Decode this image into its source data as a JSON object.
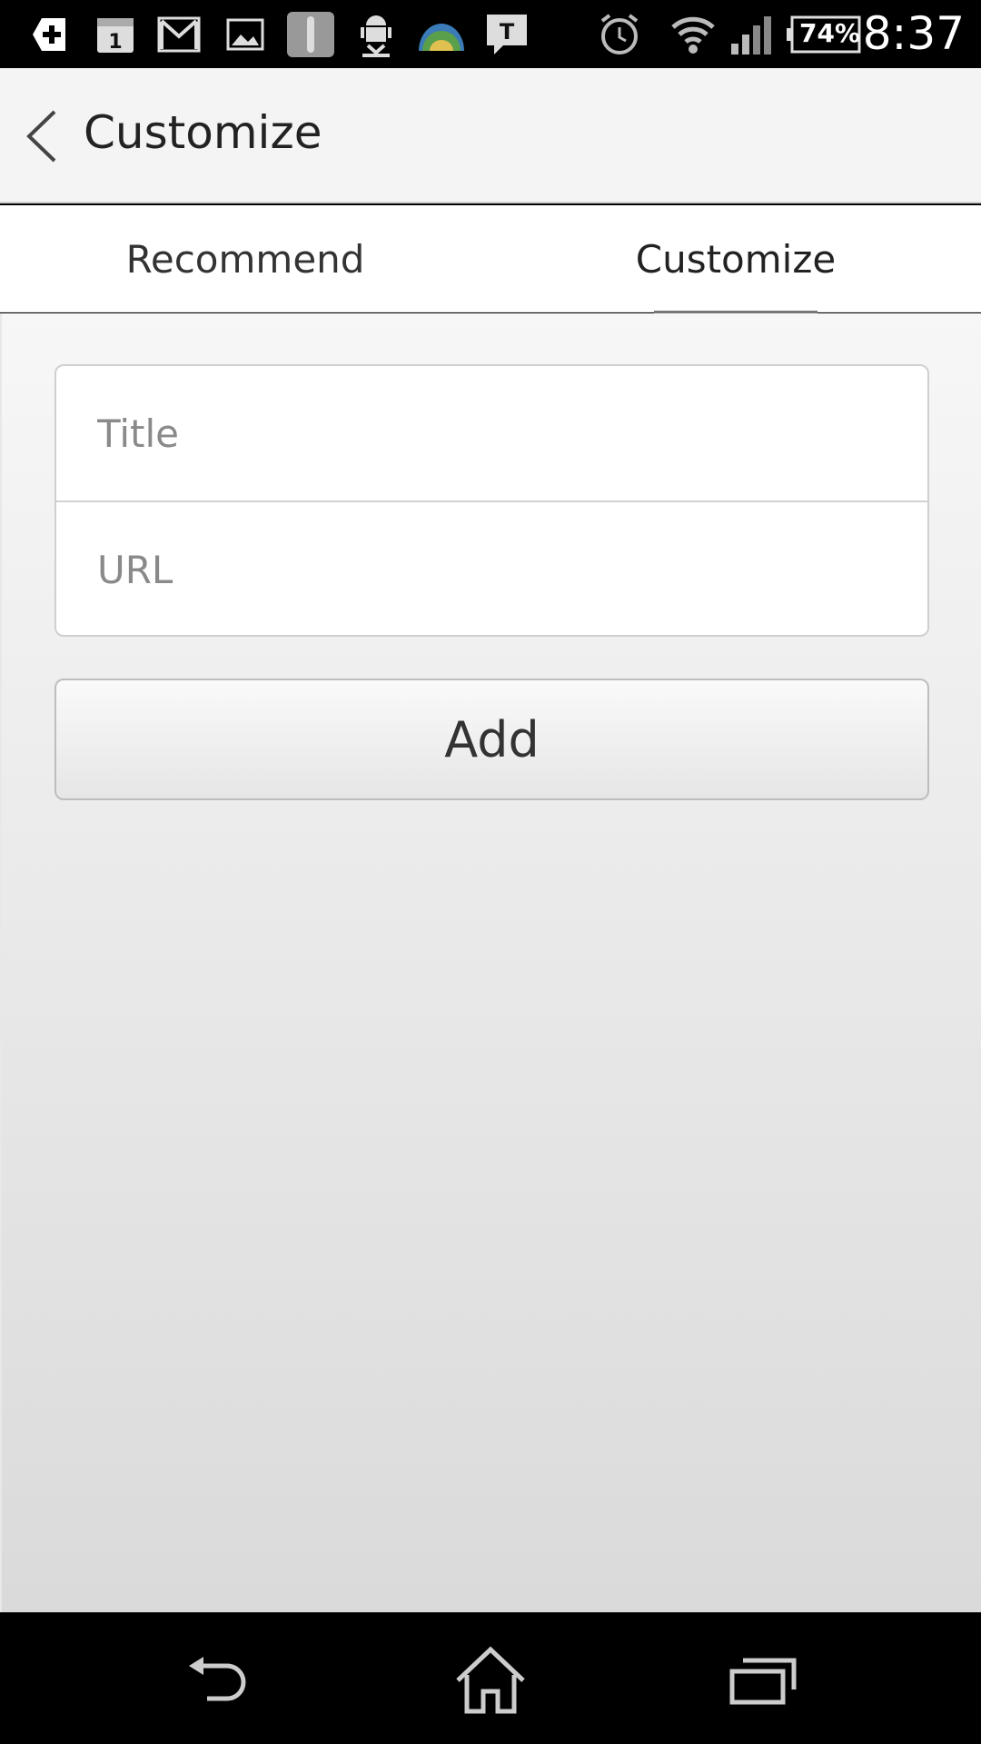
{
  "status_bar": {
    "icons": [
      "plus-badge-icon",
      "calendar-icon",
      "gmail-icon",
      "gallery-icon",
      "scrollbar-app-icon",
      "android-download-icon",
      "globe-icon",
      "t-chat-icon",
      "alarm-icon",
      "wifi-icon",
      "signal-icon",
      "battery-icon"
    ],
    "calendar_day": "1",
    "chat_letter": "T",
    "battery": "74%",
    "time": "8:37"
  },
  "app_bar": {
    "title": "Customize",
    "back_icon": "chevron-left-icon"
  },
  "tabs": [
    {
      "label": "Recommend",
      "selected": false
    },
    {
      "label": "Customize",
      "selected": true
    }
  ],
  "form": {
    "title_placeholder": "Title",
    "url_placeholder": "URL",
    "add_label": "Add"
  },
  "nav_bar": {
    "icons": [
      "back-arrow-icon",
      "home-icon",
      "recent-apps-icon"
    ]
  },
  "colors": {
    "app_bar_bg": "#f4f4f4",
    "tab_underline": "#777777",
    "text": "#222222",
    "placeholder": "#8a8a8a"
  }
}
